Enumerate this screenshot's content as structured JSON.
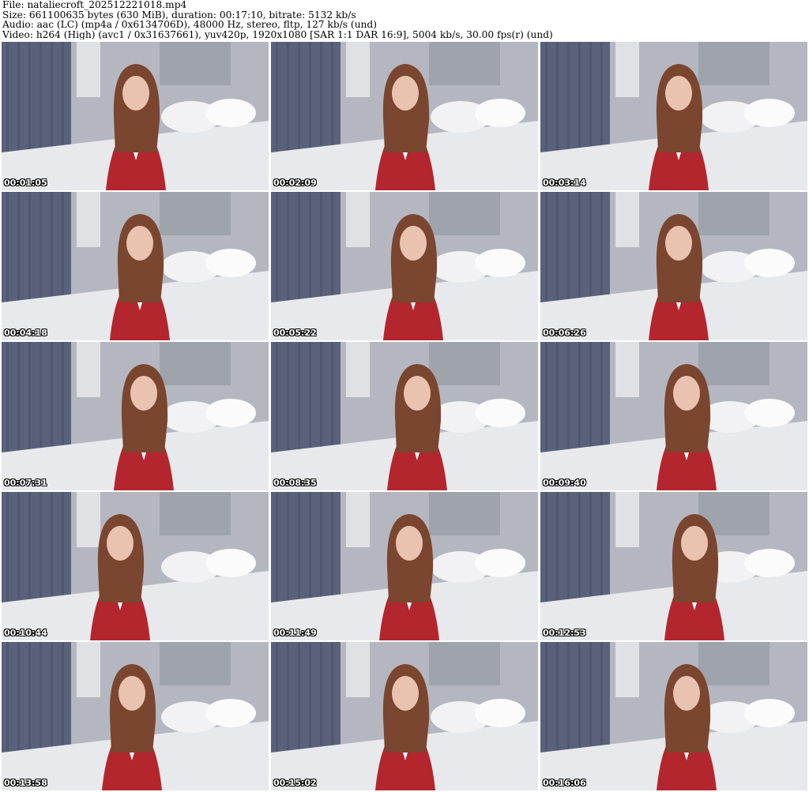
{
  "header": {
    "file_line": "File: nataliecroft_202512221018.mp4",
    "size_line": "Size: 661100635 bytes (630 MiB), duration: 00:17:10, bitrate: 5132 kb/s",
    "audio_line": "Audio: aac (LC) (mp4a / 0x6134706D), 48000 Hz, stereo, fltp, 127 kb/s (und)",
    "video_line": "Video: h264 (High) (avc1 / 0x31637661), yuv420p, 1920x1080 [SAR 1:1 DAR 16:9], 5004 kb/s, 30.00 fps(r) (und)"
  },
  "frames": [
    {
      "timestamp": "00:01:05"
    },
    {
      "timestamp": "00:02:09"
    },
    {
      "timestamp": "00:03:14"
    },
    {
      "timestamp": "00:04:18"
    },
    {
      "timestamp": "00:05:22"
    },
    {
      "timestamp": "00:06:26"
    },
    {
      "timestamp": "00:07:31"
    },
    {
      "timestamp": "00:08:35"
    },
    {
      "timestamp": "00:09:40"
    },
    {
      "timestamp": "00:10:44"
    },
    {
      "timestamp": "00:11:49"
    },
    {
      "timestamp": "00:12:53"
    },
    {
      "timestamp": "00:13:58"
    },
    {
      "timestamp": "00:15:02"
    },
    {
      "timestamp": "00:16:06"
    }
  ],
  "colors": {
    "curtain": "#59627a",
    "wall": "#b4b7bf",
    "bed": "#e8e9ec",
    "plaid": "#b3262d",
    "hair": "#7a4630",
    "skin": "#e9c3b0",
    "timestamp_text": "#ffffff"
  }
}
